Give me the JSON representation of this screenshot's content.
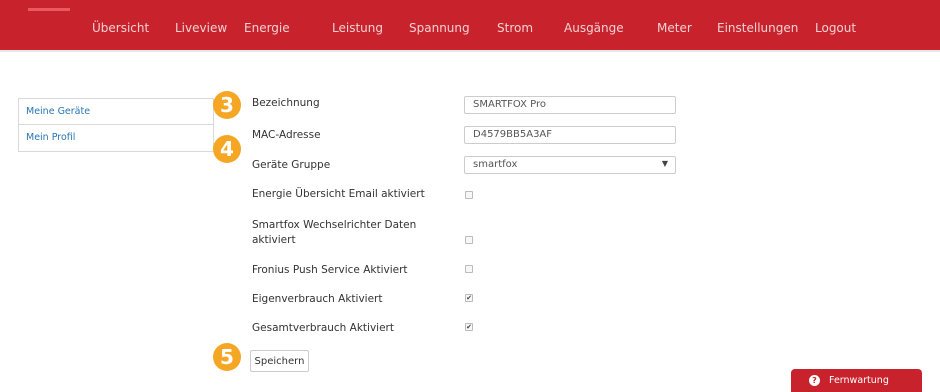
{
  "nav": {
    "items": [
      "Übersicht",
      "Liveview",
      "Energie",
      "Leistung",
      "Spannung",
      "Strom",
      "Ausgänge",
      "Meter",
      "Einstellungen",
      "Logout"
    ]
  },
  "sidebar": {
    "items": [
      "Meine Geräte",
      "Mein Profil"
    ]
  },
  "steps": [
    "3",
    "4",
    "5"
  ],
  "form": {
    "bezeichnung": {
      "label": "Bezeichnung",
      "value": "SMARTFOX Pro"
    },
    "mac": {
      "label": "MAC-Adresse",
      "value": "D4579BB5A3AF"
    },
    "gruppe": {
      "label": "Geräte Gruppe",
      "value": "smartfox"
    },
    "energie_email": {
      "label": "Energie Übersicht Email aktiviert",
      "checked": false
    },
    "wechselrichter": {
      "label": "Smartfox Wechselrichter Daten aktiviert",
      "checked": false
    },
    "fronius": {
      "label": "Fronius Push Service Aktiviert",
      "checked": false
    },
    "eigenverbrauch": {
      "label": "Eigenverbrauch Aktiviert",
      "checked": true
    },
    "gesamtverbrauch": {
      "label": "Gesamtverbrauch Aktiviert",
      "checked": true
    },
    "save_label": "Speichern",
    "check_glyph": "✔"
  },
  "remote": {
    "label": "Fernwartung",
    "icon_glyph": "?"
  },
  "colors": {
    "brand_red": "#c8232c",
    "badge_orange": "#f5a623",
    "link_blue": "#2a75b3"
  }
}
